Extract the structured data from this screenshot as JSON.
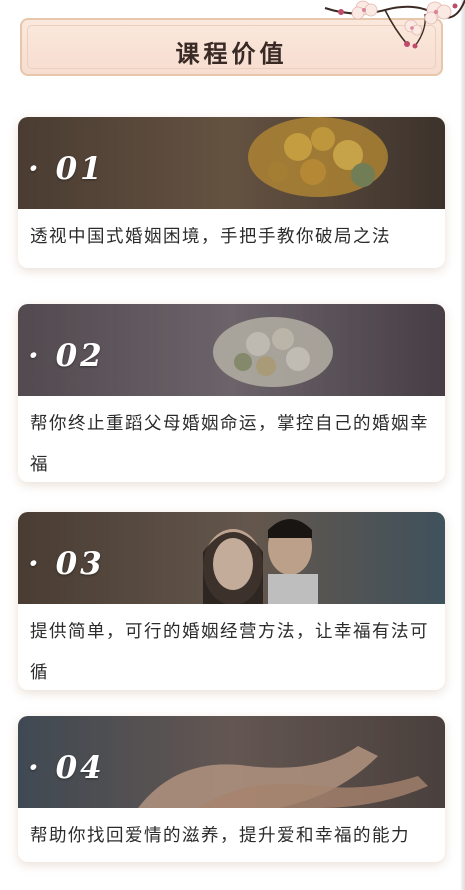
{
  "header": {
    "title": "课程价值"
  },
  "cards": [
    {
      "number": "· 01",
      "text": "透视中国式婚姻困境，手把手教你破局之法"
    },
    {
      "number": "· 02",
      "text": "帮你终止重蹈父母婚姻命运，掌控自己的婚姻幸福"
    },
    {
      "number": "· 03",
      "text": "提供简单，可行的婚姻经营方法，让幸福有法可循"
    },
    {
      "number": "· 04",
      "text": "帮助你找回爱情的滋养，提升爱和幸福的能力"
    }
  ],
  "colors": {
    "header_border": "#e7c7ab",
    "header_bg": "#fbe8dc",
    "title": "#3a2a26",
    "text": "#2b2b2b"
  }
}
